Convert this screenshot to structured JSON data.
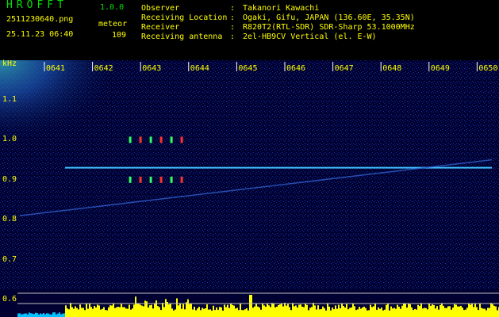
{
  "header": {
    "app_title": "HROFFT",
    "app_version": "1.0.0",
    "file_name": "2511230640.png",
    "date_time": "25.11.23 06:40",
    "type_label": "meteor",
    "count_value": "109",
    "info": [
      {
        "label": "Observer",
        "value": "Takanori Kawachi"
      },
      {
        "label": "Receiving Location",
        "value": "Ogaki, Gifu, JAPAN (136.60E, 35.35N)"
      },
      {
        "label": "Receiver",
        "value": "R820T2(RTL-SDR) SDR-Sharp 53.1000MHz"
      },
      {
        "label": "Receiving antenna",
        "value": "2el-HB9CV Vertical (el. E-W)"
      }
    ],
    "separator": ":"
  },
  "spectrogram": {
    "y_unit": "kHz",
    "y_ticks": [
      "1.1",
      "1.0",
      "0.9",
      "0.8",
      "0.7",
      "0.6"
    ],
    "x_ticks": [
      "0641",
      "0642",
      "0643",
      "0644",
      "0645",
      "0646",
      "0647",
      "0648",
      "0649",
      "0650"
    ],
    "colors": {
      "background": "#000033",
      "carrier": "#40c0ff",
      "axis_text": "#ffff00",
      "bars": "#ffff00",
      "bars_edge": "#00c0ff"
    },
    "meteor_echoes_minutes": [
      0.4,
      0.65,
      0.9,
      1.15,
      1.4,
      1.65
    ],
    "carrier_frequency_khz": 0.93,
    "satellite_trace_khz": [
      0.81,
      0.95
    ]
  }
}
